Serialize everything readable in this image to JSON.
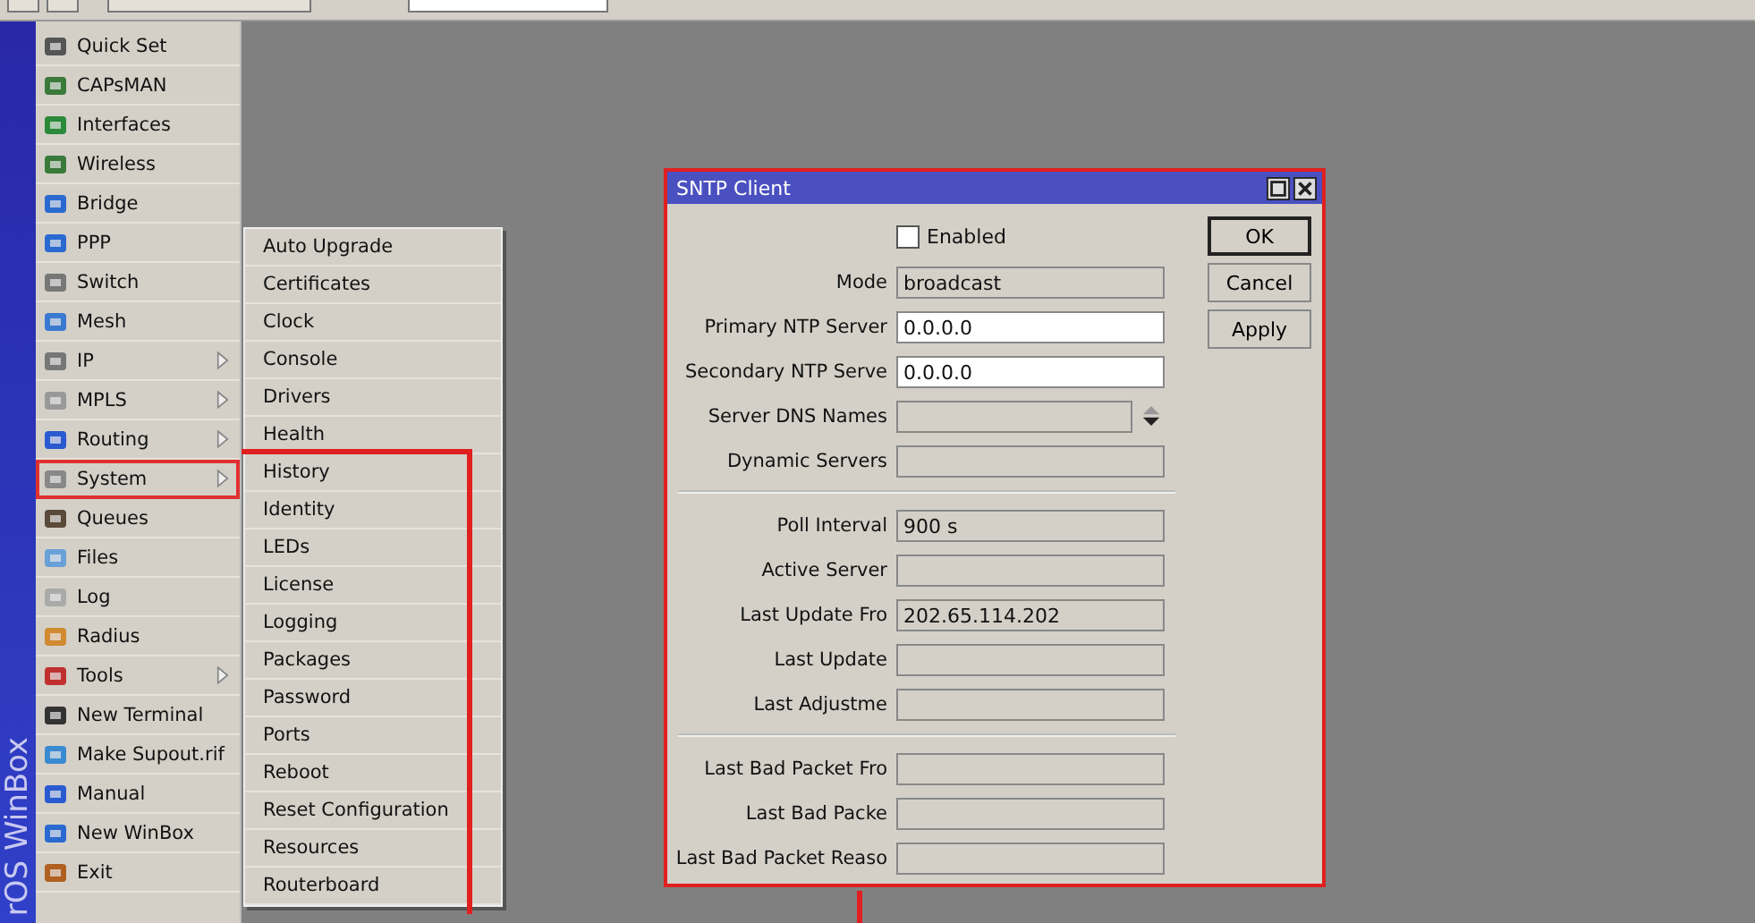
{
  "sidebar": {
    "brand": "rOS WinBox",
    "items": [
      {
        "label": "Quick Set",
        "submenu": false,
        "selected": false
      },
      {
        "label": "CAPsMAN",
        "submenu": false,
        "selected": false
      },
      {
        "label": "Interfaces",
        "submenu": false,
        "selected": false
      },
      {
        "label": "Wireless",
        "submenu": false,
        "selected": false
      },
      {
        "label": "Bridge",
        "submenu": false,
        "selected": false
      },
      {
        "label": "PPP",
        "submenu": false,
        "selected": false
      },
      {
        "label": "Switch",
        "submenu": false,
        "selected": false
      },
      {
        "label": "Mesh",
        "submenu": false,
        "selected": false
      },
      {
        "label": "IP",
        "submenu": true,
        "selected": false
      },
      {
        "label": "MPLS",
        "submenu": true,
        "selected": false
      },
      {
        "label": "Routing",
        "submenu": true,
        "selected": false
      },
      {
        "label": "System",
        "submenu": true,
        "selected": true
      },
      {
        "label": "Queues",
        "submenu": false,
        "selected": false
      },
      {
        "label": "Files",
        "submenu": false,
        "selected": false
      },
      {
        "label": "Log",
        "submenu": false,
        "selected": false
      },
      {
        "label": "Radius",
        "submenu": false,
        "selected": false
      },
      {
        "label": "Tools",
        "submenu": true,
        "selected": false
      },
      {
        "label": "New Terminal",
        "submenu": false,
        "selected": false
      },
      {
        "label": "Make Supout.rif",
        "submenu": false,
        "selected": false
      },
      {
        "label": "Manual",
        "submenu": false,
        "selected": false
      },
      {
        "label": "New WinBox",
        "submenu": false,
        "selected": false
      },
      {
        "label": "Exit",
        "submenu": false,
        "selected": false
      }
    ]
  },
  "submenu": {
    "items": [
      "Auto Upgrade",
      "Certificates",
      "Clock",
      "Console",
      "Drivers",
      "Health",
      "History",
      "Identity",
      "LEDs",
      "License",
      "Logging",
      "Packages",
      "Password",
      "Ports",
      "Reboot",
      "Reset Configuration",
      "Resources",
      "Routerboard"
    ]
  },
  "window": {
    "title": "SNTP Client",
    "enabled": {
      "label": "Enabled",
      "checked": false
    },
    "groups": [
      [
        {
          "label": "Mode",
          "value": "broadcast",
          "editable": false,
          "spinner": false
        },
        {
          "label": "Primary NTP Server",
          "value": "0.0.0.0",
          "editable": true,
          "spinner": false
        },
        {
          "label": "Secondary NTP Serve",
          "value": "0.0.0.0",
          "editable": true,
          "spinner": false
        },
        {
          "label": "Server DNS Names",
          "editable": false,
          "spinner": true
        },
        {
          "label": "Dynamic Servers",
          "editable": false,
          "spinner": false
        }
      ],
      [
        {
          "label": "Poll Interval",
          "value": "900 s",
          "editable": false,
          "spinner": false
        },
        {
          "label": "Active Server",
          "editable": false,
          "spinner": false
        },
        {
          "label": "Last Update Fro",
          "value": "202.65.114.202",
          "editable": false,
          "spinner": false
        },
        {
          "label": "Last Update",
          "editable": false,
          "spinner": false
        },
        {
          "label": "Last Adjustme",
          "editable": false,
          "spinner": false
        }
      ],
      [
        {
          "label": "Last Bad Packet Fro",
          "editable": false,
          "spinner": false
        },
        {
          "label": "Last Bad Packe",
          "editable": false,
          "spinner": false
        },
        {
          "label": "Last Bad Packet Reaso",
          "editable": false,
          "spinner": false
        }
      ]
    ],
    "buttons": [
      {
        "label": "OK",
        "default": true
      },
      {
        "label": "Cancel",
        "default": false
      },
      {
        "label": "Apply",
        "default": false
      }
    ]
  }
}
